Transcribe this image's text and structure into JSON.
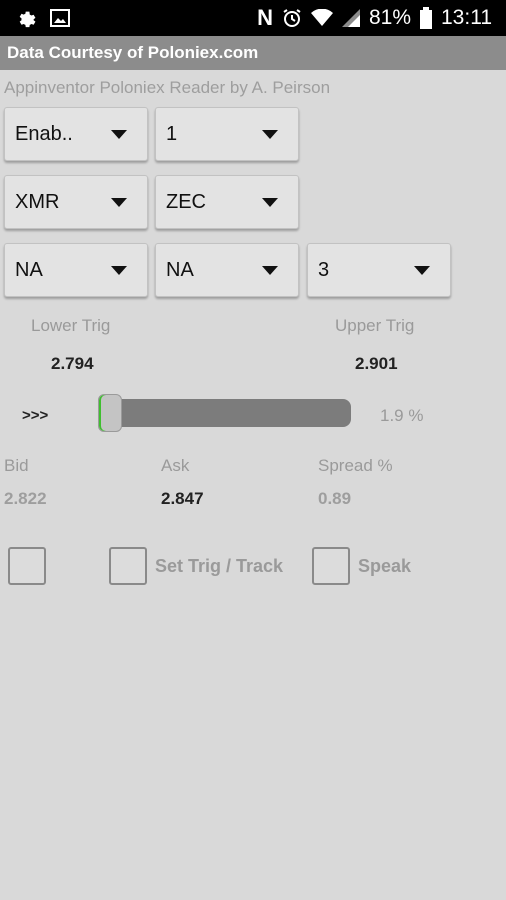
{
  "status_bar": {
    "battery_percent": "81%",
    "time": "13:11",
    "icons": [
      "gear-icon",
      "image-icon",
      "nfc-icon",
      "alarm-icon",
      "wifi-icon",
      "signal-icon",
      "battery-icon"
    ]
  },
  "app": {
    "title": "Data Courtesy of Poloniex.com",
    "subtitle": "Appinventor Poloniex Reader by A. Peirson"
  },
  "spinners": {
    "enable": "Enab..",
    "interval": "1",
    "base": "XMR",
    "quote": "ZEC",
    "opt_a": "NA",
    "opt_b": "NA",
    "opt_c": "3"
  },
  "triggers": {
    "lower_label": "Lower Trig",
    "lower_value": "2.794",
    "upper_label": "Upper Trig",
    "upper_value": "2.901"
  },
  "slider": {
    "prefix": ">>>",
    "percent_text": "1.9 %",
    "level_fraction": 0.0
  },
  "quotes": {
    "bid_label": "Bid",
    "bid_value": "2.822",
    "ask_label": "Ask",
    "ask_value": "2.847",
    "spread_label": "Spread %",
    "spread_value": "0.89"
  },
  "checkboxes": {
    "set_trig_label": "Set Trig / Track",
    "speak_label": "Speak"
  },
  "colors": {
    "title_bar": "#8c8c8c",
    "background": "#d9d9d9",
    "slider_accent": "#3fbf2f"
  }
}
